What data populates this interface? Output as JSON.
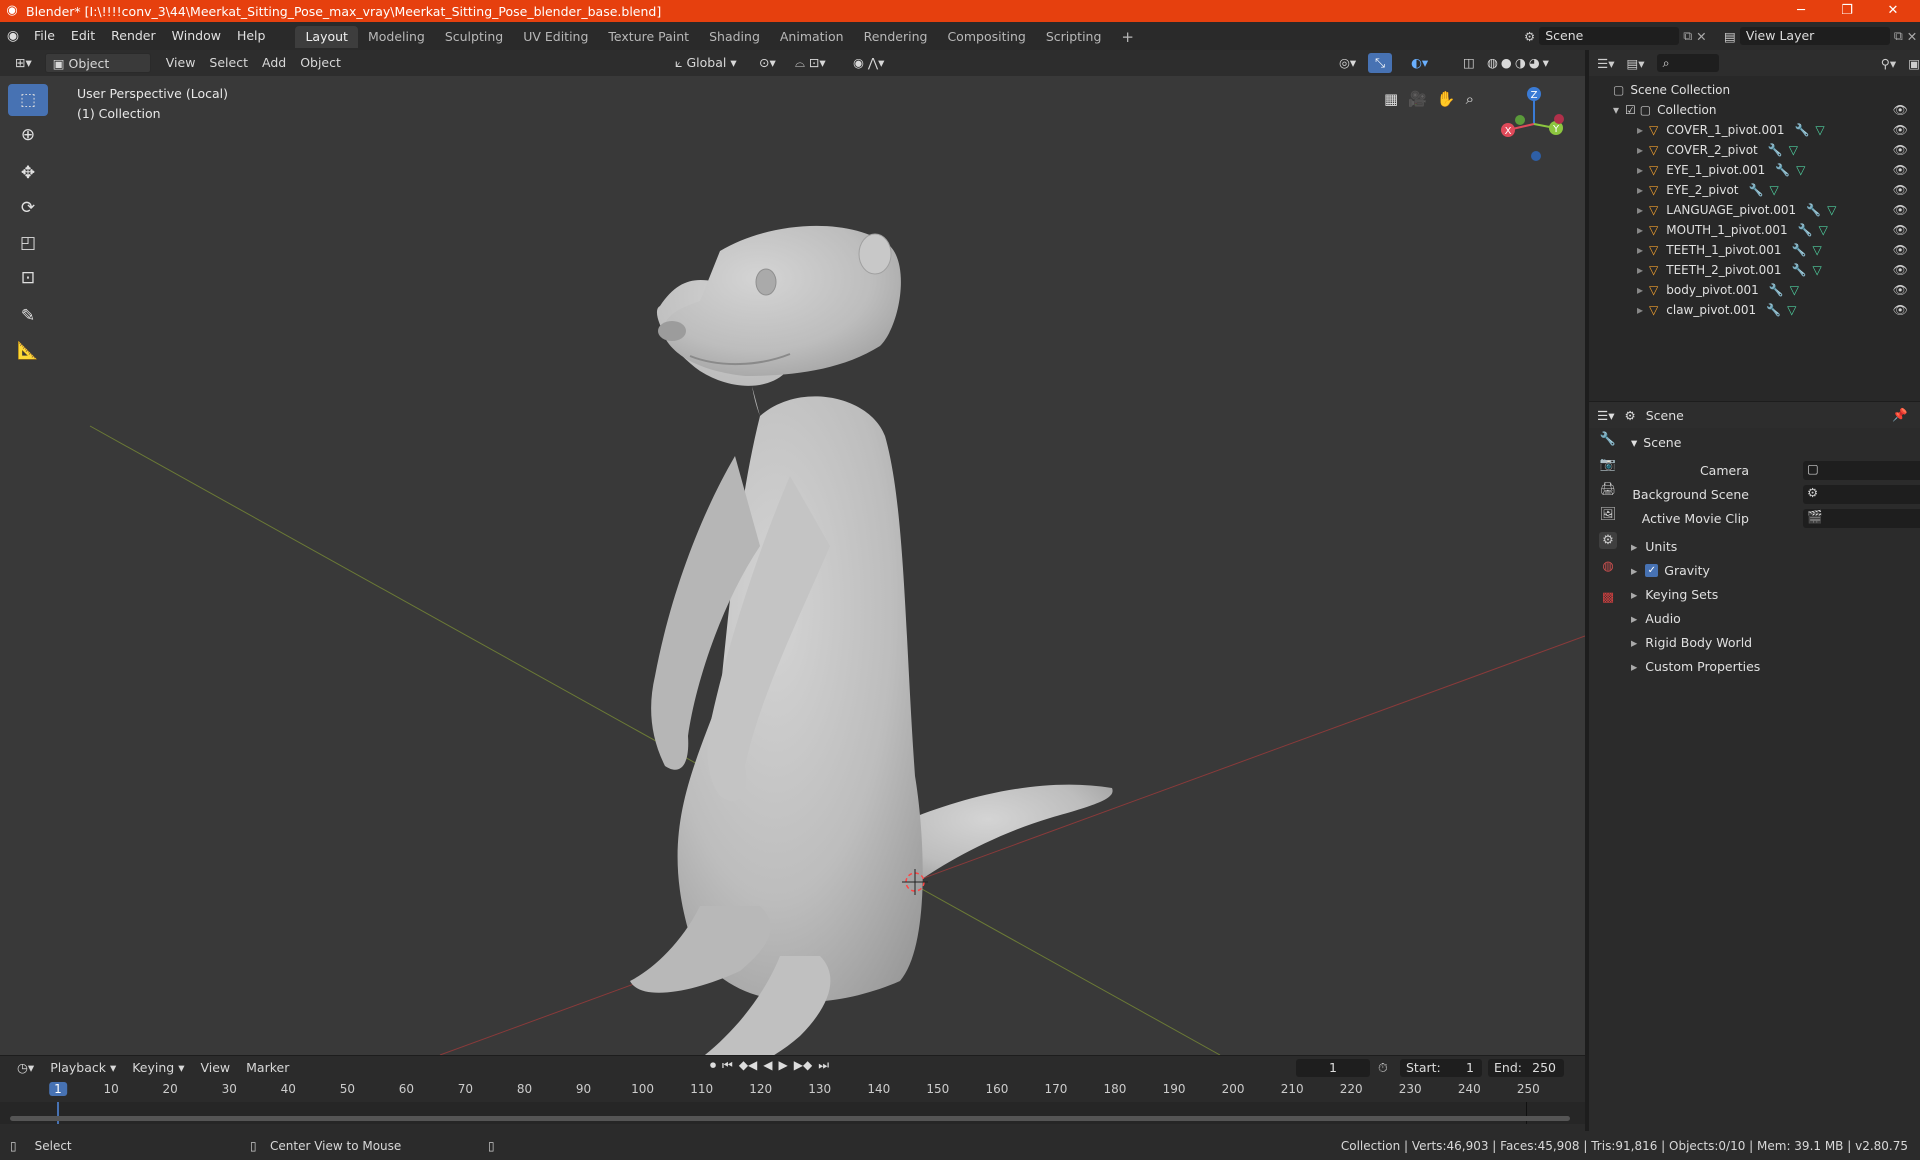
{
  "titlebar": {
    "title": "Blender* [I:\\!!!!conv_3\\44\\Meerkat_Sitting_Pose_max_vray\\Meerkat_Sitting_Pose_blender_base.blend]",
    "bg_color": "#e6400e"
  },
  "menu": {
    "items": [
      "File",
      "Edit",
      "Render",
      "Window",
      "Help"
    ],
    "workspaces": [
      "Layout",
      "Modeling",
      "Sculpting",
      "UV Editing",
      "Texture Paint",
      "Shading",
      "Animation",
      "Rendering",
      "Compositing",
      "Scripting"
    ],
    "active_workspace": "Layout",
    "add_tab": "+",
    "scene_value": "Scene",
    "view_layer_value": "View Layer"
  },
  "viewport_header": {
    "mode": "Object Mode",
    "menus": [
      "View",
      "Select",
      "Add",
      "Object"
    ],
    "orientation": "Global"
  },
  "viewport": {
    "view_label": "User Perspective (Local)",
    "collection_label": "(1) Collection",
    "gizmo_axes": [
      "X",
      "Y",
      "Z"
    ],
    "bg_color": "#393939"
  },
  "outliner": {
    "root": "Scene Collection",
    "collection": "Collection",
    "objects": [
      "COVER_1_pivot.001",
      "COVER_2_pivot",
      "EYE_1_pivot.001",
      "EYE_2_pivot",
      "LANGUAGE_pivot.001",
      "MOUTH_1_pivot.001",
      "TEETH_1_pivot.001",
      "TEETH_2_pivot.001",
      "body_pivot.001",
      "claw_pivot.001"
    ]
  },
  "properties": {
    "context": "Scene",
    "panel": "Scene",
    "fields": [
      {
        "label": "Camera"
      },
      {
        "label": "Background Scene"
      },
      {
        "label": "Active Movie Clip"
      }
    ],
    "subpanels": [
      "Units",
      "Gravity",
      "Keying Sets",
      "Audio",
      "Rigid Body World",
      "Custom Properties"
    ],
    "gravity_checked": true
  },
  "timeline": {
    "menus": [
      "Playback",
      "Keying",
      "View",
      "Marker"
    ],
    "current_frame": "1",
    "start_label": "Start:",
    "start_value": "1",
    "end_label": "End:",
    "end_value": "250",
    "ticks": [
      "1",
      "10",
      "20",
      "30",
      "40",
      "50",
      "60",
      "70",
      "80",
      "90",
      "100",
      "110",
      "120",
      "130",
      "140",
      "150",
      "160",
      "170",
      "180",
      "190",
      "200",
      "210",
      "220",
      "230",
      "240",
      "250"
    ]
  },
  "statusbar": {
    "left_action": "Select",
    "middle_action": "Center View to Mouse",
    "stats": "Collection | Verts:46,903 | Faces:45,908 | Tris:91,816 | Objects:0/10 | Mem: 39.1 MB | v2.80.75"
  }
}
